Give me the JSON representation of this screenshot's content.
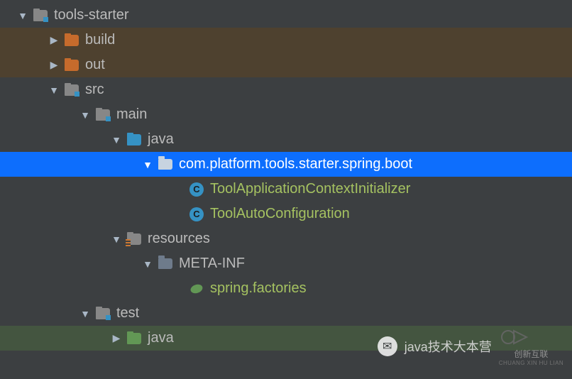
{
  "tree": {
    "root": {
      "label": "tools-starter"
    },
    "build": {
      "label": "build"
    },
    "out": {
      "label": "out"
    },
    "src": {
      "label": "src"
    },
    "main": {
      "label": "main"
    },
    "java_main": {
      "label": "java"
    },
    "pkg": {
      "label": "com.platform.tools.starter.spring.boot"
    },
    "cls1": {
      "label": "ToolApplicationContextInitializer"
    },
    "cls2": {
      "label": "ToolAutoConfiguration"
    },
    "resources": {
      "label": "resources"
    },
    "metainf": {
      "label": "META-INF"
    },
    "factories": {
      "label": "spring.factories"
    },
    "test": {
      "label": "test"
    },
    "java_test": {
      "label": "java"
    }
  },
  "class_letter": "C",
  "watermark": {
    "wechat_label": "java技术大本营",
    "brand_cn": "创新互联",
    "brand_en": "CHUANG XIN HU LIAN"
  }
}
